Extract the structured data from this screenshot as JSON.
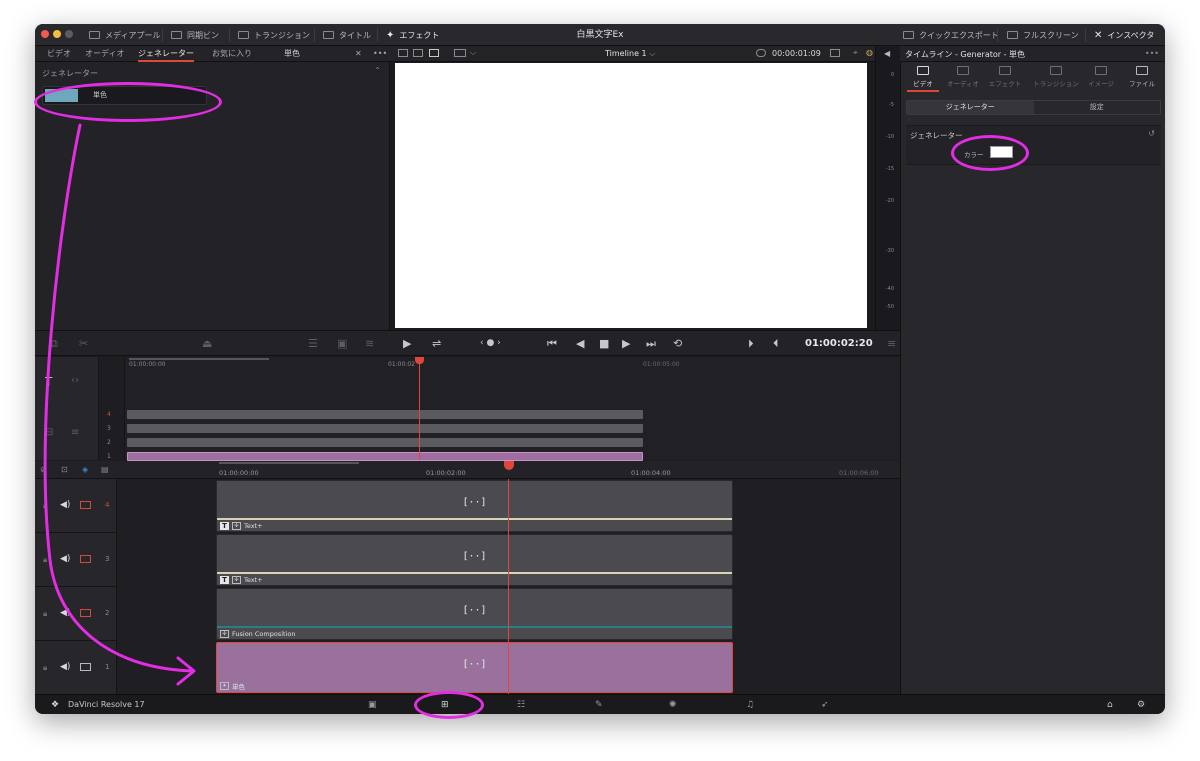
{
  "toolbar": {
    "items": [
      "メディアプール",
      "同期ビン",
      "トランジション",
      "タイトル",
      "エフェクト"
    ],
    "project_title": "白黒文字Ex",
    "right_items": [
      "クイックエクスポート",
      "フルスクリーン",
      "インスペクタ"
    ]
  },
  "media_tabs": [
    "ビデオ",
    "オーディオ",
    "ジェネレーター",
    "お気に入り"
  ],
  "effects_search_text": "単色",
  "generators": {
    "header": "ジェネレーター",
    "items": [
      {
        "label": "単色",
        "swatch_color": "#6fa8bc"
      }
    ]
  },
  "viewer": {
    "timeline_name": "Timeline 1",
    "timecode_top": "00:00:01:09",
    "timecode_main": "01:00:02:20"
  },
  "audio_meter": {
    "ticks": [
      "0",
      "-5",
      "-10",
      "-15",
      "-20",
      "-30",
      "-40",
      "-50"
    ]
  },
  "inspector": {
    "title": "タイムライン - Generator - 単色",
    "tabs": [
      "ビデオ",
      "オーディオ",
      "エフェクト",
      "トランジション",
      "イメージ",
      "ファイル"
    ],
    "subtabs": [
      "ジェネレーター",
      "設定"
    ],
    "section": "ジェネレーター",
    "color_label": "カラー",
    "color_value": "#ffffff"
  },
  "upper_timeline": {
    "ruler": [
      "01:00:00:00",
      "01:00:02",
      "01:00:05:00"
    ],
    "tracks": [
      "4",
      "3",
      "2",
      "1"
    ]
  },
  "timeline": {
    "ruler": [
      "01:00:00:00",
      "01:00:02:00",
      "01:00:04:00",
      "01:00:06:00"
    ],
    "tracks": [
      {
        "number": "4",
        "clip": "Text+",
        "line_color": "#d9d3b7"
      },
      {
        "number": "3",
        "clip": "Text+",
        "line_color": "#d9d3b7"
      },
      {
        "number": "2",
        "clip": "Fusion Composition",
        "line_color": "#2c7e86"
      },
      {
        "number": "1",
        "clip": "単色",
        "line_color": ""
      }
    ]
  },
  "app_name": "DaVinci Resolve 17"
}
